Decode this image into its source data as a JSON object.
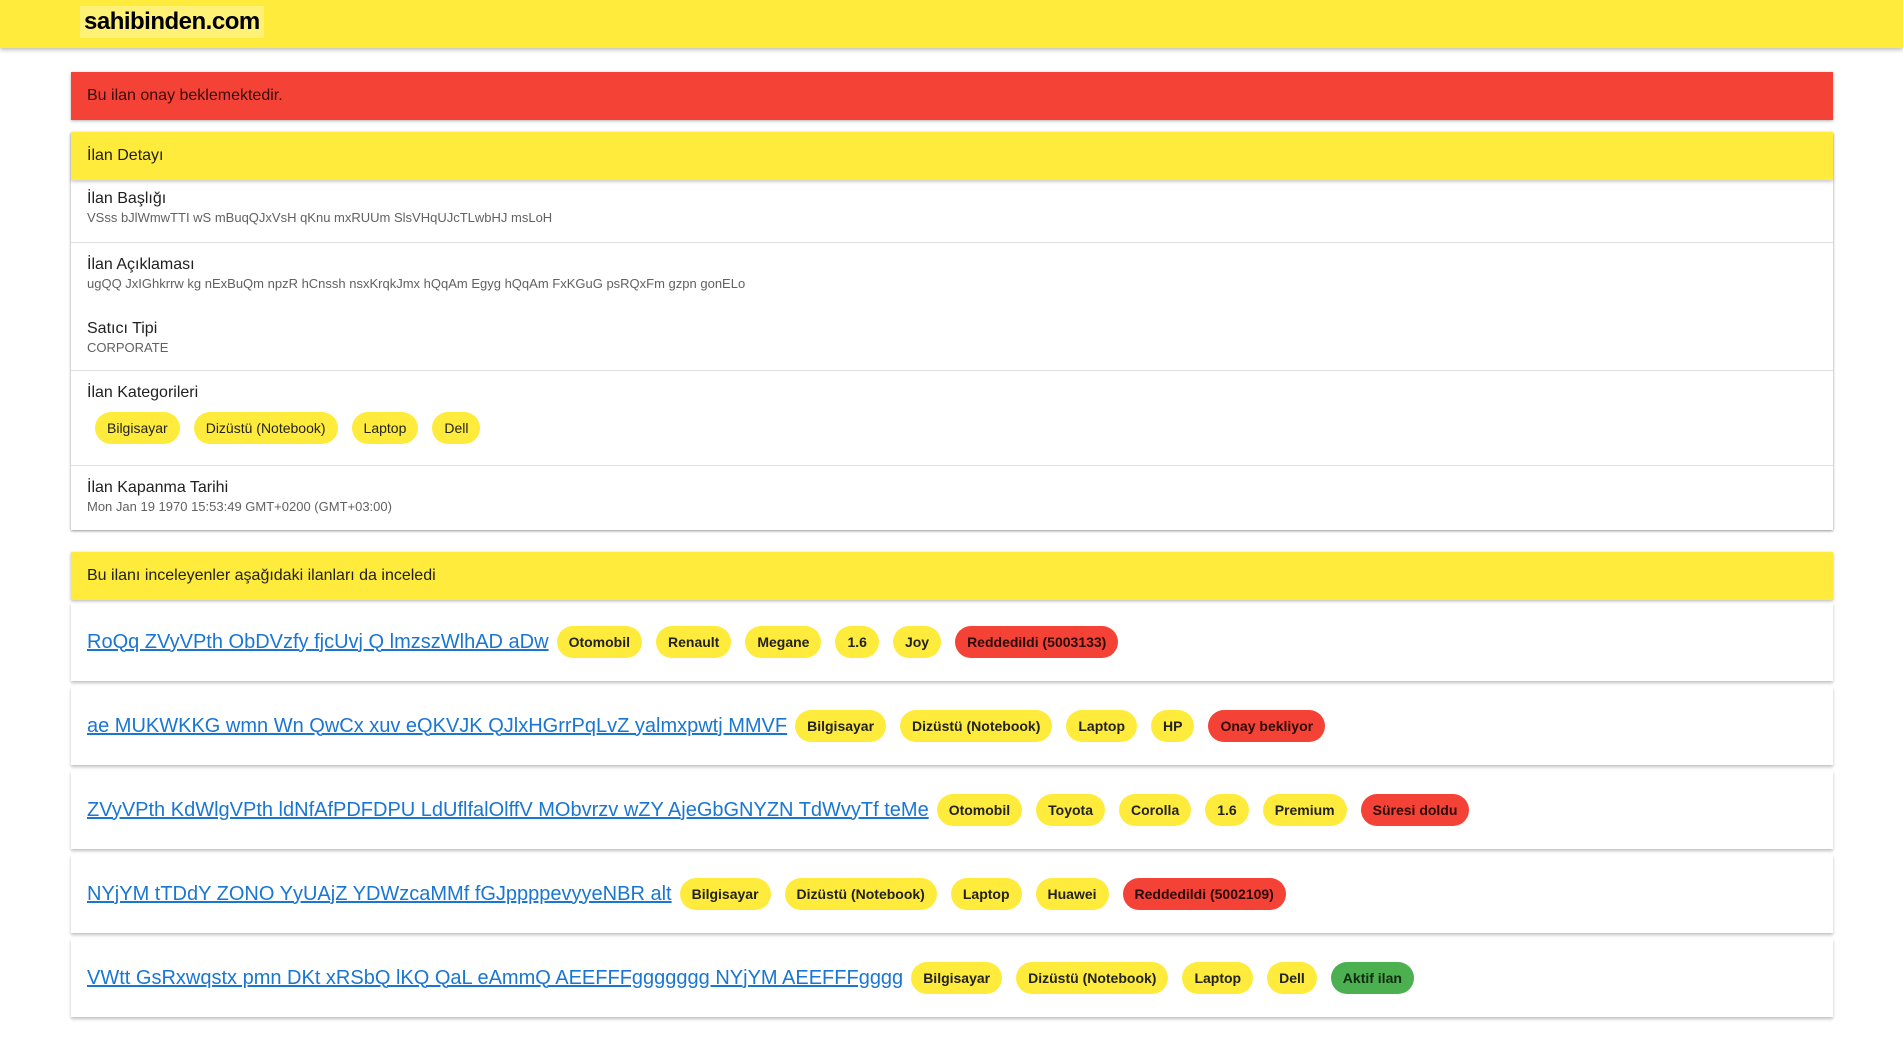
{
  "header": {
    "logo": "sahibinden.com"
  },
  "alert": {
    "text": "Bu ilan onay beklemektedir."
  },
  "detail": {
    "header": "İlan Detayı",
    "title_label": "İlan Başlığı",
    "title_value": "VSss bJlWmwTTI wS mBuqQJxVsH qKnu mxRUUm SlsVHqUJcTLwbHJ msLoH",
    "description_label": "İlan Açıklaması",
    "description_value": "ugQQ JxIGhkrrw kg nExBuQm npzR hCnssh nsxKrqkJmx hQqAm Egyg hQqAm FxKGuG psRQxFm gzpn gonELo",
    "seller_label": "Satıcı Tipi",
    "seller_value": "CORPORATE",
    "categories_label": "İlan Kategorileri",
    "categories": [
      "Bilgisayar",
      "Dizüstü (Notebook)",
      "Laptop",
      "Dell"
    ],
    "close_label": "İlan Kapanma Tarihi",
    "close_value": "Mon Jan 19 1970 15:53:49 GMT+0200 (GMT+03:00)"
  },
  "related": {
    "header": "Bu ilanı inceleyenler aşağıdaki ilanları da inceledi",
    "items": [
      {
        "title": "RoQq ZVyVPth ObDVzfy fjcUvj Q lmzszWlhAD aDw",
        "tags": [
          "Otomobil",
          "Renault",
          "Megane",
          "1.6",
          "Joy"
        ],
        "status": "Reddedildi (5003133)",
        "status_color": "#f44336"
      },
      {
        "title": "ae MUKWKKG wmn Wn QwCx xuv eQKVJK QJlxHGrrPqLvZ yalmxpwtj MMVF",
        "tags": [
          "Bilgisayar",
          "Dizüstü (Notebook)",
          "Laptop",
          "HP"
        ],
        "status": "Onay bekliyor",
        "status_color": "#f44336"
      },
      {
        "title": "ZVyVPth KdWlgVPth ldNfAfPDFDPU LdUflfalOlffV MObvrzv wZY AjeGbGNYZN TdWvyTf teMe",
        "tags": [
          "Otomobil",
          "Toyota",
          "Corolla",
          "1.6",
          "Premium"
        ],
        "status": "Süresi doldu",
        "status_color": "#f44336"
      },
      {
        "title": "NYjYM tTDdY ZONO YyUAjZ YDWzcaMMf fGJppppevyyeNBR alt",
        "tags": [
          "Bilgisayar",
          "Dizüstü (Notebook)",
          "Laptop",
          "Huawei"
        ],
        "status": "Reddedildi (5002109)",
        "status_color": "#f44336"
      },
      {
        "title": "VWtt GsRxwqstx pmn DKt xRSbQ lKQ QaL eAmmQ AEEFFFggggggg NYjYM AEEFFFgggg",
        "tags": [
          "Bilgisayar",
          "Dizüstü (Notebook)",
          "Laptop",
          "Dell"
        ],
        "status": "Aktif ilan",
        "status_color": "#4caf50"
      }
    ]
  }
}
